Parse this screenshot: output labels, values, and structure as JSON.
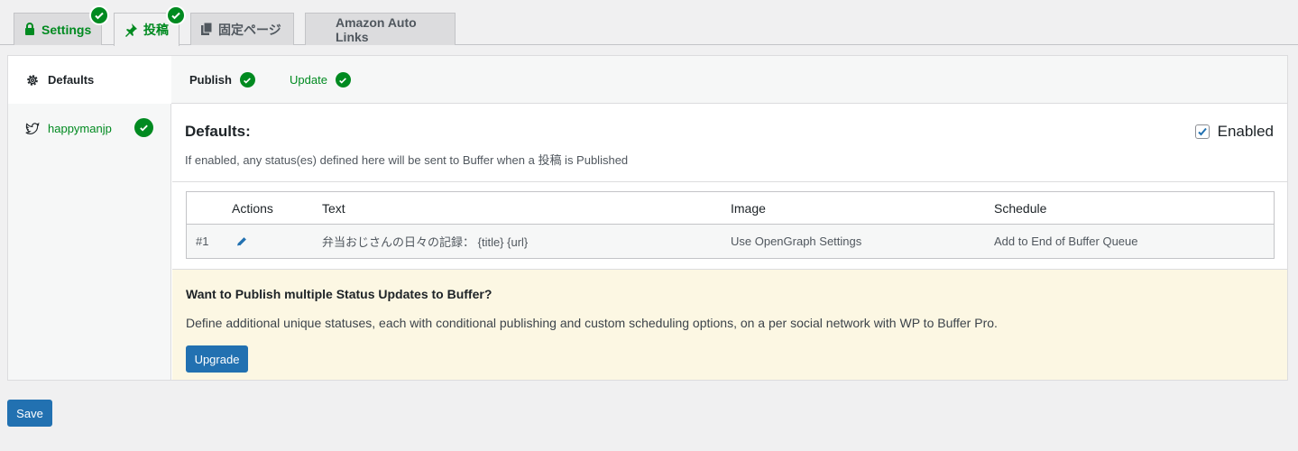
{
  "nav_tabs": [
    {
      "label": "Settings",
      "icon": "lock-icon",
      "verified": true
    },
    {
      "label": "投稿",
      "icon": "pin-icon",
      "verified": true
    },
    {
      "label": "固定ページ",
      "icon": "pages-icon",
      "verified": false
    },
    {
      "label": "Amazon Auto Links",
      "icon": "",
      "verified": false
    }
  ],
  "sidebar": {
    "defaults_label": "Defaults",
    "account_label": "happymanjp",
    "account_icon": "twitter-icon"
  },
  "subtabs": {
    "publish_label": "Publish",
    "update_label": "Update"
  },
  "content": {
    "heading": "Defaults:",
    "enabled_label": "Enabled",
    "enabled_checked": true,
    "description": "If enabled, any status(es) defined here will be sent to Buffer when a 投稿 is Published"
  },
  "table": {
    "headers": [
      "",
      "Actions",
      "Text",
      "Image",
      "Schedule"
    ],
    "rows": [
      {
        "num": "#1",
        "text": "弁当おじさんの日々の記録： {title} {url}",
        "image": "Use OpenGraph Settings",
        "schedule": "Add to End of Buffer Queue"
      }
    ]
  },
  "upsell": {
    "title": "Want to Publish multiple Status Updates to Buffer?",
    "body": "Define additional unique statuses, each with conditional publishing and custom scheduling options, on a per social network with WP to Buffer Pro.",
    "button_label": "Upgrade"
  },
  "footer": {
    "save_label": "Save"
  },
  "colors": {
    "accent": "#2271b1",
    "success": "#008a20",
    "upsell_bg": "#fcf7e3"
  }
}
